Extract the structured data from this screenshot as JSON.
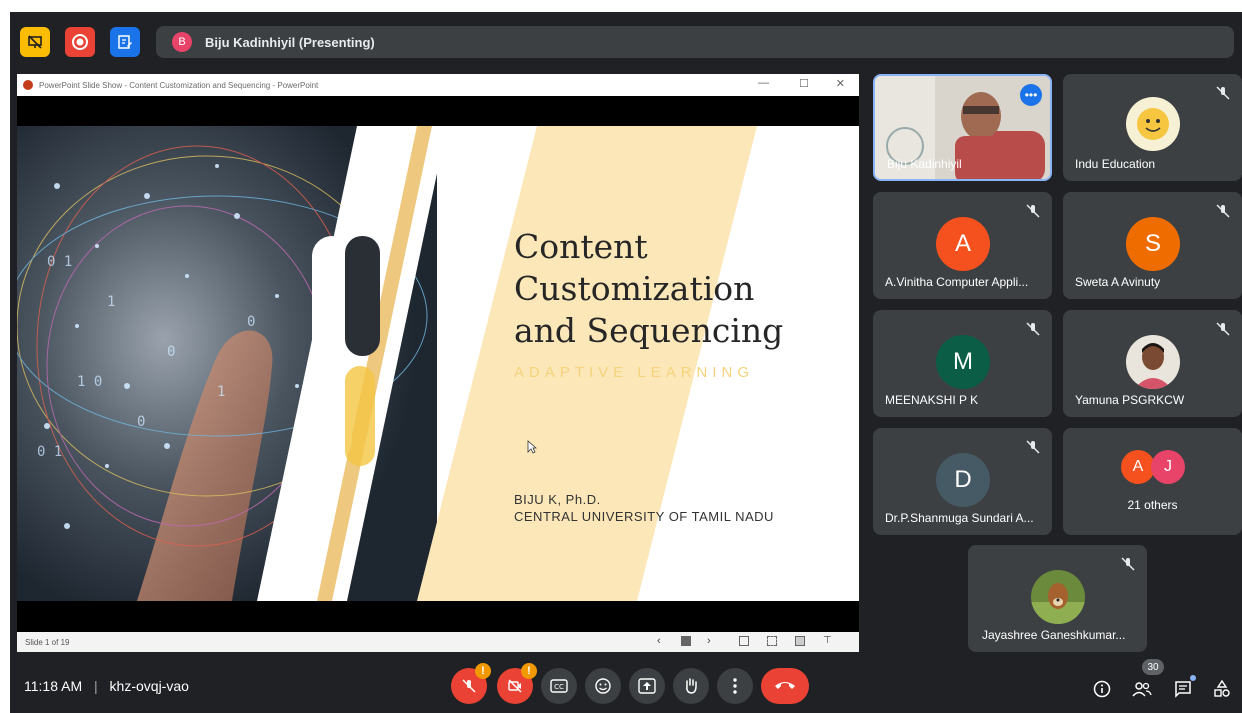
{
  "presenting": {
    "avatar_letter": "B",
    "label": "Biju Kadinhiyil (Presenting)"
  },
  "ppt": {
    "window_title": "PowerPoint Slide Show - Content Customization and Sequencing - PowerPoint",
    "slide_status": "Slide 1 of 19",
    "slide": {
      "title_line1": "Content",
      "title_line2": "Customization",
      "title_line3": "and Sequencing",
      "subtitle": "ADAPTIVE LEARNING",
      "author_line1": "BIJU K, Ph.D.",
      "author_line2": "CENTRAL UNIVERSITY OF TAMIL NADU"
    }
  },
  "participants": [
    {
      "name": "Biju Kadinhiyil",
      "type": "video"
    },
    {
      "name": "Indu Education",
      "type": "image"
    },
    {
      "name": "A.Vinitha Computer Appli...",
      "letter": "A",
      "color": "#f4511e"
    },
    {
      "name": "Sweta A Avinuty",
      "letter": "S",
      "color": "#ef6c00"
    },
    {
      "name": "MEENAKSHI P K",
      "letter": "M",
      "color": "#0b5e45"
    },
    {
      "name": "Yamuna PSGRKCW",
      "type": "image"
    },
    {
      "name": "Dr.P.Shanmuga Sundari A...",
      "letter": "D",
      "color": "#455a64"
    },
    {
      "name": "21 others",
      "letters": [
        "A",
        "J"
      ],
      "colors": [
        "#f4511e",
        "#e84368"
      ]
    },
    {
      "name": "Jayashree Ganeshkumar...",
      "type": "image"
    }
  ],
  "bottom": {
    "time": "11:18 AM",
    "separator": "|",
    "meeting_code": "khz-ovqj-vao",
    "participant_count": "30",
    "warn_symbol": "!"
  },
  "colors": {
    "background": "#202124",
    "tile": "#3c4043",
    "danger": "#ea4335",
    "accent": "#8ab4f8"
  }
}
